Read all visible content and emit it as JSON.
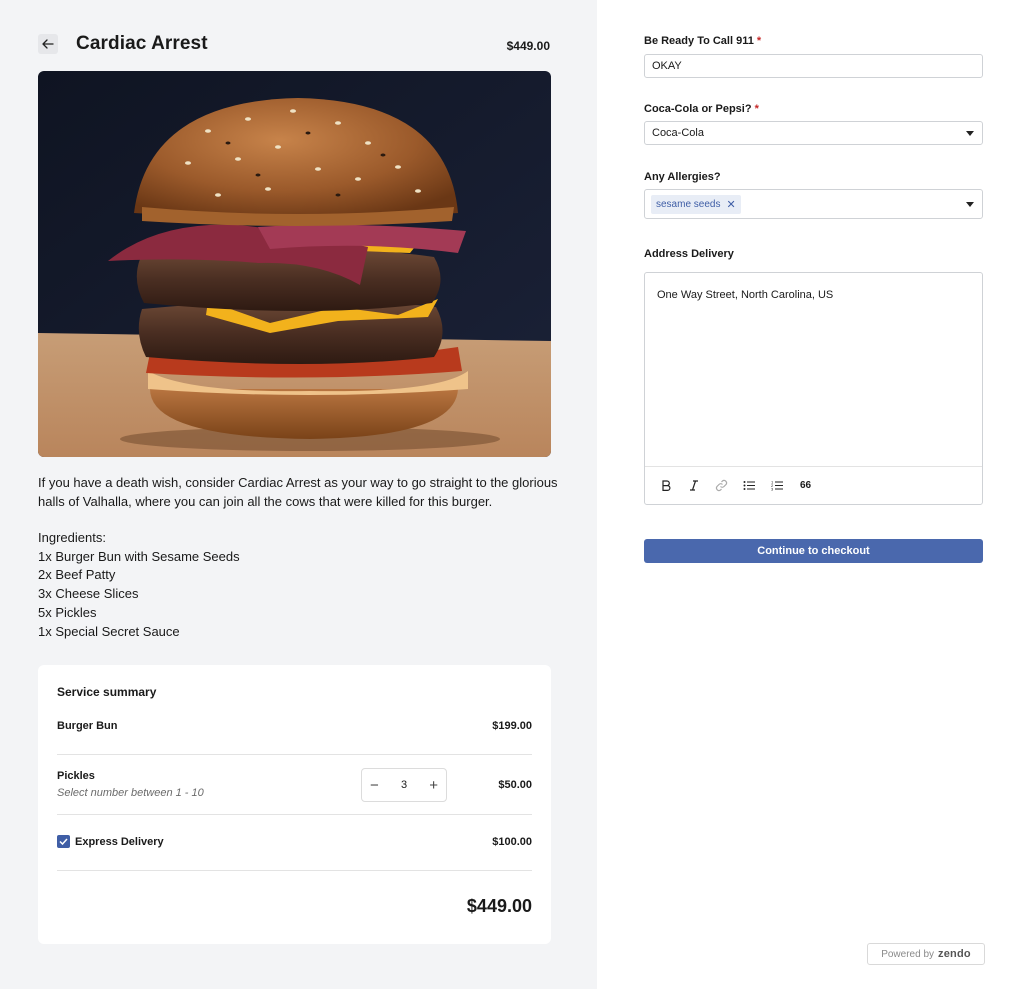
{
  "product": {
    "title": "Cardiac Arrest",
    "price": "$449.00",
    "description": "If you have a death wish, consider Cardiac Arrest as your way to go straight to the glorious halls of Valhalla, where you can join all the cows that were killed for this burger.",
    "ingredients_heading": "Ingredients:",
    "ingredients": [
      "1x Burger Bun with Sesame Seeds",
      "2x Beef Patty",
      "3x Cheese Slices",
      "5x Pickles",
      "1x Special Secret Sauce"
    ]
  },
  "summary": {
    "title": "Service summary",
    "rows": [
      {
        "label": "Burger Bun",
        "price": "$199.00"
      },
      {
        "label": "Pickles",
        "sublabel": "Select number between 1 - 10",
        "quantity": "3",
        "price": "$50.00"
      },
      {
        "label": "Express Delivery",
        "price": "$100.00",
        "checked": true
      }
    ],
    "total": "$449.00"
  },
  "form": {
    "field1": {
      "label": "Be Ready To Call 911",
      "required": "*",
      "value": "OKAY"
    },
    "field2": {
      "label": "Coca-Cola or Pepsi?",
      "required": "*",
      "value": "Coca-Cola"
    },
    "field3": {
      "label": "Any Allergies?",
      "tag": "sesame seeds"
    },
    "field4": {
      "label": "Address Delivery",
      "value": "One Way Street, North Carolina, US"
    },
    "toolbar": {
      "quote_label": "66"
    },
    "checkout_label": "Continue to checkout"
  },
  "footer": {
    "powered_by": "Powered by",
    "brand": "zendo"
  },
  "colors": {
    "accent": "#4a68ad",
    "required": "#c62828",
    "panel": "#f3f4f6"
  }
}
